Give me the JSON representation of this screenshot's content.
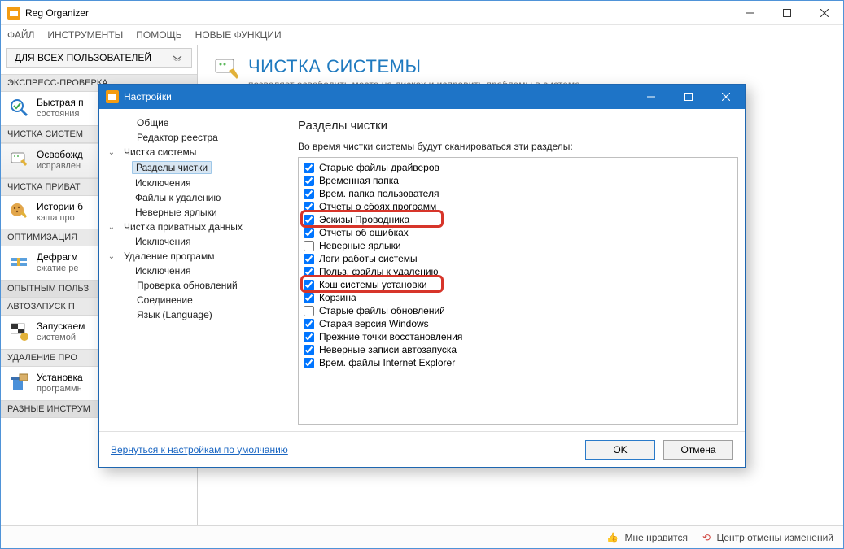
{
  "main_title": "Reg Organizer",
  "menu": {
    "file": "ФАЙЛ",
    "tools": "ИНСТРУМЕНТЫ",
    "help": "ПОМОЩЬ",
    "new": "НОВЫЕ ФУНКЦИИ"
  },
  "user_scope": "ДЛЯ ВСЕХ ПОЛЬЗОВАТЕЛЕЙ",
  "sidebar": {
    "express_header": "ЭКСПРЕСС-ПРОВЕРКА",
    "express": {
      "t1": "Быстрая п",
      "t2": "состояния"
    },
    "clean_header": "ЧИСТКА СИСТЕМ",
    "clean": {
      "t1": "Освобожд",
      "t2": "исправлен"
    },
    "privacy_header": "ЧИСТКА ПРИВАТ",
    "privacy": {
      "t1": "Истории б",
      "t2": "кэша про"
    },
    "opt_header": "ОПТИМИЗАЦИЯ",
    "opt": {
      "t1": "Дефрагм",
      "t2": "сжатие ре"
    },
    "expert_header": "ОПЫТНЫМ ПОЛЬЗ",
    "autorun_header": "АВТОЗАПУСК П",
    "autorun": {
      "t1": "Запускаем",
      "t2": "системой"
    },
    "uninstall_header": "УДАЛЕНИЕ ПРО",
    "uninstall": {
      "t1": "Установка",
      "t2": "программн"
    },
    "misc_header": "РАЗНЫЕ ИНСТРУМ"
  },
  "page": {
    "title": "ЧИСТКА СИСТЕМЫ",
    "sub": "позволяет освободить место на дисках и исправить проблемы в системе."
  },
  "statusbar": {
    "like": "Мне нравится",
    "undo": "Центр отмены изменений"
  },
  "dialog": {
    "title": "Настройки",
    "tree": {
      "general": "Общие",
      "registry": "Редактор реестра",
      "systemclean": "Чистка системы",
      "sections": "Разделы чистки",
      "exclusions": "Исключения",
      "files_to_delete": "Файлы к удалению",
      "bad_shortcuts": "Неверные ярлыки",
      "privacy_clean": "Чистка приватных данных",
      "priv_exclusions": "Исключения",
      "uninstall": "Удаление программ",
      "uni_exclusions": "Исключения",
      "updates_check": "Проверка обновлений",
      "connection": "Соединение",
      "language": "Язык (Language)"
    },
    "right_title": "Разделы чистки",
    "right_desc": "Во время чистки системы будут сканироваться эти разделы:",
    "items": [
      {
        "label": "Старые файлы драйверов",
        "checked": true
      },
      {
        "label": "Временная папка",
        "checked": true
      },
      {
        "label": "Врем. папка пользователя",
        "checked": true
      },
      {
        "label": "Отчеты о сбоях программ",
        "checked": true
      },
      {
        "label": "Эскизы Проводника",
        "checked": true,
        "highlight": true
      },
      {
        "label": "Отчеты об ошибках",
        "checked": true
      },
      {
        "label": "Неверные ярлыки",
        "checked": false
      },
      {
        "label": "Логи работы системы",
        "checked": true
      },
      {
        "label": "Польз. файлы к удалению",
        "checked": true
      },
      {
        "label": "Кэш системы установки",
        "checked": true,
        "highlight": true
      },
      {
        "label": "Корзина",
        "checked": true
      },
      {
        "label": "Старые файлы обновлений",
        "checked": false
      },
      {
        "label": "Старая версия Windows",
        "checked": true
      },
      {
        "label": "Прежние точки восстановления",
        "checked": true
      },
      {
        "label": "Неверные записи автозапуска",
        "checked": true
      },
      {
        "label": "Врем. файлы Internet Explorer",
        "checked": true
      }
    ],
    "reset_link": "Вернуться к настройкам по умолчанию",
    "ok": "OK",
    "cancel": "Отмена"
  }
}
